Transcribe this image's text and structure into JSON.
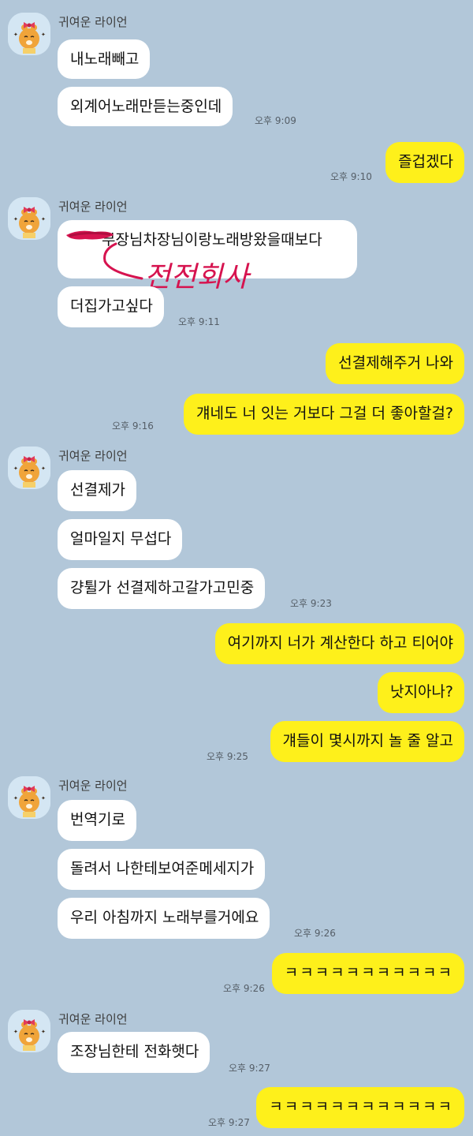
{
  "sender_name": "귀여운 라이언",
  "messages": {
    "m1": "내노래빼고",
    "m2": "외계어노래만듣는중인데",
    "m3": "즐겁겠다",
    "m4": "부장님차장님이랑노래방왔을때보다",
    "m5": "더집가고싶다",
    "m6": "선결제해주거 나와",
    "m7": "걔네도 너 잇는 거보다 그걸 더 좋아할걸?",
    "m8": "선결제가",
    "m9": "얼마일지 무섭다",
    "m10": "걍튈가 선결제하고갈가고민중",
    "m11": "여기까지 너가 계산한다 하고 티어야",
    "m12": "낫지아나?",
    "m13": "걔들이 몇시까지 놀 줄 알고",
    "m14": "번역기로",
    "m15": "돌려서 나한테보여준메세지가",
    "m16": "우리 아침까지 노래부를거에요",
    "m17": "ㅋㅋㅋㅋㅋㅋㅋㅋㅋㅋㅋ",
    "m18": "조장님한테 전화햇다",
    "m19": "ㅋㅋㅋㅋㅋㅋㅋㅋㅋㅋㅋㅋ"
  },
  "times": {
    "t1": "오후 9:09",
    "t2": "오후 9:10",
    "t3": "오후 9:11",
    "t4": "오후 9:16",
    "t5": "오후 9:23",
    "t6": "오후 9:25",
    "t7": "오후 9:26",
    "t8": "오후 9:26",
    "t9": "오후 9:27",
    "t10": "오후 9:27"
  },
  "annotation_text": "전전회사",
  "colors": {
    "background": "#b2c7d9",
    "incoming_bubble": "#ffffff",
    "outgoing_bubble": "#fef01b",
    "annotation": "#d6134f"
  },
  "icons": {
    "avatar": "lion-character-avatar"
  }
}
